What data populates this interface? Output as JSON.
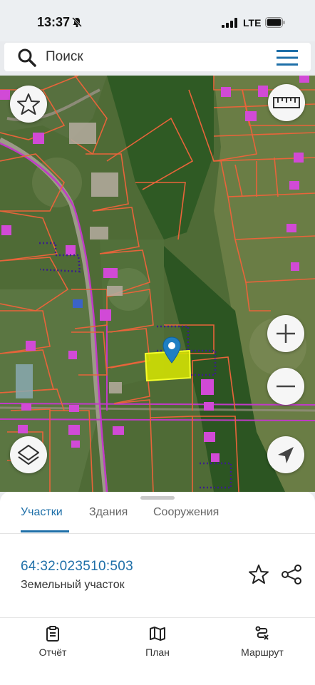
{
  "status_bar": {
    "time": "13:37",
    "network": "LTE"
  },
  "search": {
    "placeholder": "Поиск"
  },
  "tabs": [
    {
      "label": "Участки",
      "active": true
    },
    {
      "label": "Здания",
      "active": false
    },
    {
      "label": "Сооружения",
      "active": false
    }
  ],
  "parcel": {
    "cadastral_number": "64:32:023510:503",
    "type": "Земельный участок"
  },
  "bottom_nav": [
    {
      "label": "Отчёт",
      "icon": "clipboard-icon"
    },
    {
      "label": "План",
      "icon": "map-icon"
    },
    {
      "label": "Маршрут",
      "icon": "route-icon"
    }
  ],
  "colors": {
    "accent": "#1e6fa8",
    "parcel_outline": "#e8643a",
    "selected_parcel": "#e8f000",
    "building": "#d14ad6",
    "zone_dotted": "#3a1f8a"
  }
}
